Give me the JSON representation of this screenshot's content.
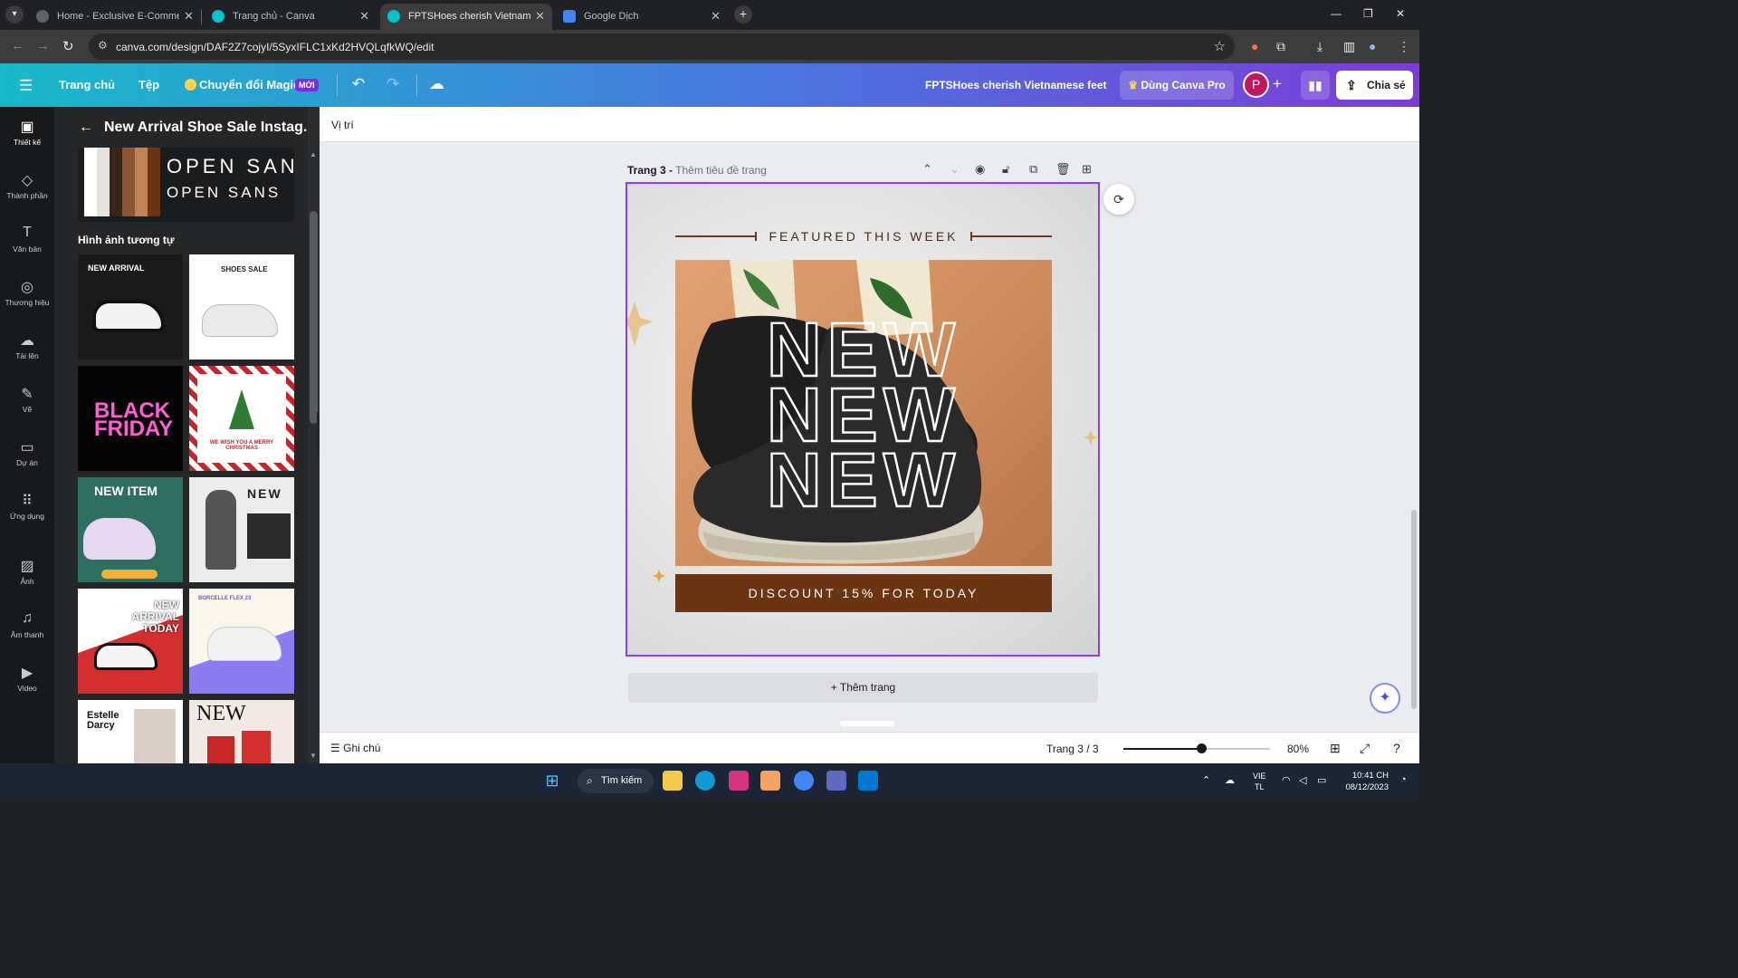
{
  "browser": {
    "tabs": [
      {
        "title": "Home - Exclusive E-Commerce",
        "active": false
      },
      {
        "title": "Trang chủ - Canva",
        "active": false
      },
      {
        "title": "FPTSHoes cherish Vietnamese feet",
        "active": true
      },
      {
        "title": "Google Dịch",
        "active": false
      }
    ],
    "url": "canva.com/design/DAF2Z7cojyI/5SyxIFLC1xKd2HVQLqfkWQ/edit"
  },
  "header": {
    "nav": [
      "Trang chủ",
      "Tệp"
    ],
    "magic_label": "Chuyển đổi Magic",
    "magic_badge": "MỚI",
    "doc_title": "FPTSHoes cherish Vietnamese feet",
    "pro_label": "Dùng Canva Pro",
    "avatar_initial": "P",
    "share_label": "Chia sẻ"
  },
  "rail": [
    {
      "label": "Thiết kế",
      "icon": "layout-icon"
    },
    {
      "label": "Thành phần",
      "icon": "shapes-icon"
    },
    {
      "label": "Văn bản",
      "icon": "text-icon"
    },
    {
      "label": "Thương hiệu",
      "icon": "brand-icon"
    },
    {
      "label": "Tải lên",
      "icon": "upload-icon"
    },
    {
      "label": "Vẽ",
      "icon": "draw-icon"
    },
    {
      "label": "Dự án",
      "icon": "folder-icon"
    },
    {
      "label": "Ứng dụng",
      "icon": "apps-icon"
    },
    {
      "label": "Ảnh",
      "icon": "photo-icon"
    },
    {
      "label": "Âm thanh",
      "icon": "music-icon"
    },
    {
      "label": "Video",
      "icon": "video-icon"
    }
  ],
  "panel": {
    "title": "New Arrival Shoe Sale Instag...",
    "font_primary": "OPEN SANS",
    "font_secondary": "OPEN SANS",
    "palette": [
      "#ffffff",
      "#e8e2dc",
      "#3a2417",
      "#8a5634",
      "#c08358",
      "#6b3513"
    ],
    "similar_title": "Hình ảnh tương tự",
    "thumbnails": [
      {
        "text": "NEW ARRIVAL"
      },
      {
        "text": "SHOES SALE"
      },
      {
        "text": "BLACK FRIDAY"
      },
      {
        "text": "WE WISH YOU A MERRY CHRISTMAS"
      },
      {
        "text": "NEW ITEM"
      },
      {
        "text": "NEW"
      },
      {
        "text": "NEW ARRIVAL TODAY"
      },
      {
        "text": "BORCELLE FLEX 23"
      },
      {
        "text": "Estelle Darcy"
      },
      {
        "text": "NEW"
      }
    ]
  },
  "editor": {
    "context_label": "Vị trí",
    "page_label": "Trang 3 -",
    "page_subtitle": "Thêm tiêu đề trang",
    "design": {
      "featured": "FEATURED THIS WEEK",
      "headline": [
        "NEW",
        "NEW",
        "NEW"
      ],
      "discount": "DISCOUNT 15% FOR TODAY"
    },
    "add_page": "+ Thêm trang"
  },
  "footer": {
    "notes": "Ghi chú",
    "page_indicator": "Trang 3 / 3",
    "zoom": "80%",
    "zoom_fraction": 0.53
  },
  "taskbar": {
    "search": "Tìm kiếm",
    "lang_top": "VIE",
    "lang_bottom": "TL",
    "time": "10:41 CH",
    "date": "08/12/2023"
  }
}
